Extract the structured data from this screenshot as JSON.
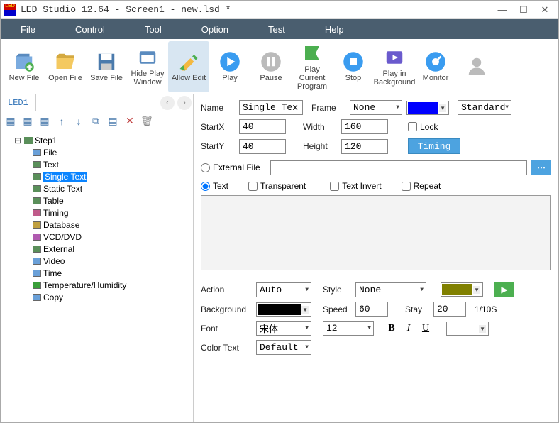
{
  "window": {
    "title": "LED Studio 12.64 - Screen1 - new.lsd *"
  },
  "menu": [
    "File",
    "Control",
    "Tool",
    "Option",
    "Test",
    "Help"
  ],
  "toolbar": [
    {
      "label": "New File",
      "icon": "newfile",
      "active": false
    },
    {
      "label": "Open File",
      "icon": "openfile",
      "active": false
    },
    {
      "label": "Save File",
      "icon": "savefile",
      "active": false
    },
    {
      "label": "Hide Play Window",
      "icon": "hidewin",
      "active": false
    },
    {
      "label": "Allow Edit",
      "icon": "allowedit",
      "active": true
    },
    {
      "label": "Play",
      "icon": "play",
      "active": false
    },
    {
      "label": "Pause",
      "icon": "pause",
      "active": false
    },
    {
      "label": "Play Current Program",
      "icon": "playcur",
      "active": false
    },
    {
      "label": "Stop",
      "icon": "stop",
      "active": false
    },
    {
      "label": "Play in Background",
      "icon": "playbg",
      "active": false
    },
    {
      "label": "Monitor",
      "icon": "monitor",
      "active": false
    },
    {
      "label": "",
      "icon": "user",
      "active": false
    }
  ],
  "sidebar": {
    "tab": "LED1",
    "tree_root": "Step1",
    "nodes": [
      {
        "label": "File",
        "icon": "#6aa0d8"
      },
      {
        "label": "Text",
        "icon": "#5a8f5a"
      },
      {
        "label": "Single Text",
        "icon": "#5a8f5a",
        "sel": true
      },
      {
        "label": "Static Text",
        "icon": "#5a8f5a"
      },
      {
        "label": "Table",
        "icon": "#5a8f5a"
      },
      {
        "label": "Timing",
        "icon": "#c05a8a"
      },
      {
        "label": "Database",
        "icon": "#c0a040"
      },
      {
        "label": "VCD/DVD",
        "icon": "#b05ab0"
      },
      {
        "label": "External",
        "icon": "#5a8f5a"
      },
      {
        "label": "Video",
        "icon": "#6aa0d8"
      },
      {
        "label": "Time",
        "icon": "#6aa0d8"
      },
      {
        "label": "Temperature/Humidity",
        "icon": "#3a9f3a"
      },
      {
        "label": "Copy",
        "icon": "#6aa0d8"
      }
    ]
  },
  "props": {
    "name_label": "Name",
    "name_value": "Single Text",
    "frame_label": "Frame",
    "frame_value": "None",
    "color_value": "#0000ff",
    "standard_label": "Standard",
    "startx_label": "StartX",
    "startx_value": "40",
    "width_label": "Width",
    "width_value": "160",
    "lock_label": "Lock",
    "starty_label": "StartY",
    "starty_value": "40",
    "height_label": "Height",
    "height_value": "120",
    "timing_btn": "Timing",
    "external_file": "External File",
    "text_radio": "Text",
    "transparent": "Transparent",
    "text_invert": "Text Invert",
    "repeat": "Repeat",
    "action_label": "Action",
    "action_value": "Auto",
    "style_label": "Style",
    "style_value": "None",
    "swatch": "#808000",
    "background_label": "Background",
    "background_value": "#000000",
    "speed_label": "Speed",
    "speed_value": "60",
    "stay_label": "Stay",
    "stay_value": "20",
    "stay_unit": "1/10S",
    "font_label": "Font",
    "font_value": "宋体",
    "font_size": "12",
    "colortext_label": "Color Text",
    "colortext_value": "Default"
  }
}
